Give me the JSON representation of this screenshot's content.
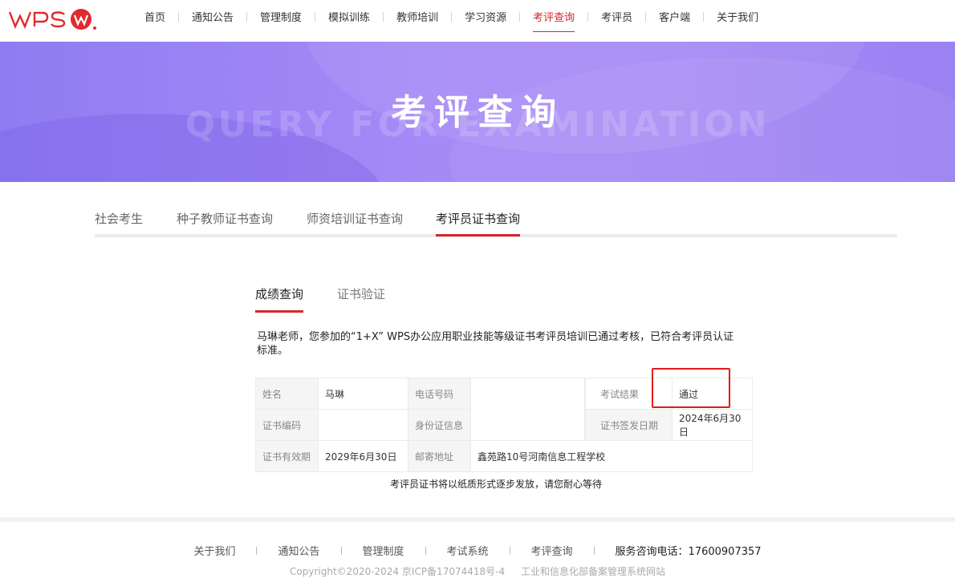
{
  "header": {
    "logo_text": "WPS",
    "nav": [
      "首页",
      "通知公告",
      "管理制度",
      "模拟训练",
      "教师培训",
      "学习资源",
      "考评查询",
      "考评员",
      "客户端",
      "关于我们"
    ],
    "active_nav": "考评查询"
  },
  "banner": {
    "title": "考评查询",
    "subtitle": "QUERY FOR EXAMINATION"
  },
  "tabs": {
    "items": [
      "社会考生",
      "种子教师证书查询",
      "师资培训证书查询",
      "考评员证书查询"
    ],
    "active": "考评员证书查询"
  },
  "subtabs": {
    "items": [
      "成绩查询",
      "证书验证"
    ],
    "active": "成绩查询"
  },
  "message": "马琳老师，您参加的“1+X” WPS办公应用职业技能等级证书考评员培训已通过考核，已符合考评员认证标准。",
  "result": {
    "name_label": "姓名",
    "name_value": "马琳",
    "phone_label": "电话号码",
    "phone_value": "",
    "exam_result_label": "考试结果",
    "exam_result_value": "通过",
    "cert_no_label": "证书编码",
    "cert_no_value": "",
    "id_label": "身份证信息",
    "id_value": "",
    "issue_date_label": "证书签发日期",
    "issue_date_value": "2024年6月30日",
    "valid_label": "证书有效期",
    "valid_value": "2029年6月30日",
    "address_label": "邮寄地址",
    "address_value": "鑫苑路10号河南信息工程学校"
  },
  "note": "考评员证书将以纸质形式逐步发放，请您耐心等待",
  "footer": {
    "links": [
      "关于我们",
      "通知公告",
      "管理制度",
      "考试系统",
      "考评查询"
    ],
    "phone": "服务咨询电话：17600907357",
    "copyright": "Copyright©2020-2024 京ICP备17074418号-4",
    "ministry": "工业和信息化部备案管理系统网站"
  },
  "colors": {
    "accent": "#d6262d",
    "banner_start": "#8f7cf2",
    "banner_end": "#a889f5",
    "highlight_box": "#e11b1b"
  }
}
